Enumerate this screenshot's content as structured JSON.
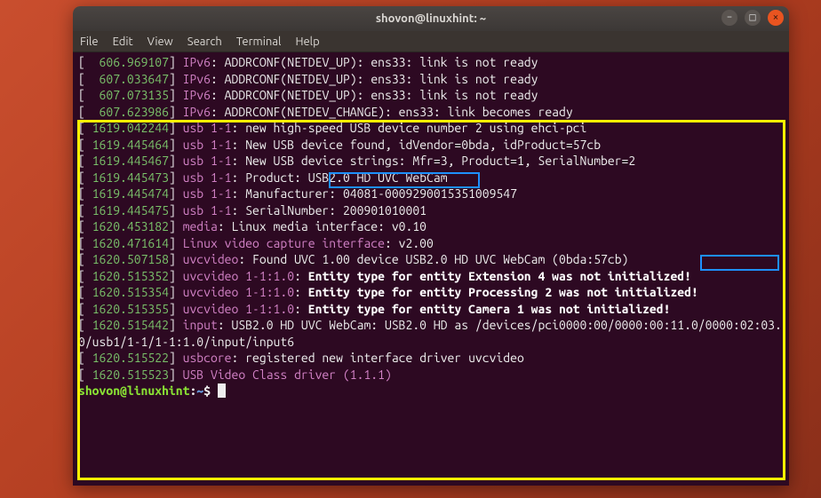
{
  "window": {
    "title": "shovon@linuxhint: ~",
    "controls": {
      "minimize": "–",
      "maximize": "□",
      "close": "×"
    }
  },
  "menu": {
    "items": [
      "File",
      "Edit",
      "View",
      "Search",
      "Terminal",
      "Help"
    ]
  },
  "terminal": {
    "lines": [
      {
        "ts": "606.969107",
        "label": "IPv6",
        "msg": ": ADDRCONF(NETDEV_UP): ens33: link is not ready"
      },
      {
        "ts": "607.033647",
        "label": "IPv6",
        "msg": ": ADDRCONF(NETDEV_UP): ens33: link is not ready"
      },
      {
        "ts": "607.073135",
        "label": "IPv6",
        "msg": ": ADDRCONF(NETDEV_UP): ens33: link is not ready"
      },
      {
        "ts": "607.623986",
        "label": "IPv6",
        "msg": ": ADDRCONF(NETDEV_CHANGE): ens33: link becomes ready"
      },
      {
        "ts": "1619.042244",
        "label": "usb 1-1",
        "msg": ": new high-speed USB device number 2 using ehci-pci"
      },
      {
        "ts": "1619.445464",
        "label": "usb 1-1",
        "msg": ": New USB device found, idVendor=0bda, idProduct=57cb"
      },
      {
        "ts": "1619.445467",
        "label": "usb 1-1",
        "msg": ": New USB device strings: Mfr=3, Product=1, SerialNumber=2"
      },
      {
        "ts": "1619.445473",
        "label": "usb 1-1",
        "msg": ": Product: USB2.0 HD UVC WebCam"
      },
      {
        "ts": "1619.445474",
        "label": "usb 1-1",
        "msg": ": Manufacturer: 04081-0009290015351009547"
      },
      {
        "ts": "1619.445475",
        "label": "usb 1-1",
        "msg": ": SerialNumber: 200901010001"
      },
      {
        "ts": "1620.453182",
        "label": "media",
        "msg": ": Linux media interface: v0.10"
      },
      {
        "ts": "1620.471614",
        "label": "Linux video capture interface",
        "msg": ": v2.00"
      },
      {
        "ts": "1620.507158",
        "label": "uvcvideo",
        "msg": ": Found UVC 1.00 device USB2.0 HD UVC WebCam (0bda:57cb)"
      },
      {
        "ts": "1620.515352",
        "label": "uvcvideo 1-1:1.0",
        "boldmsg": "Entity type for entity Extension 4 was not initialized!"
      },
      {
        "ts": "1620.515354",
        "label": "uvcvideo 1-1:1.0",
        "boldmsg": "Entity type for entity Processing 2 was not initialized!"
      },
      {
        "ts": "1620.515355",
        "label": "uvcvideo 1-1:1.0",
        "boldmsg": "Entity type for entity Camera 1 was not initialized!"
      },
      {
        "ts": "1620.515442",
        "label": "input",
        "msg": ": USB2.0 HD UVC WebCam: USB2.0 HD as /devices/pci0000:00/0000:00:11.0/0000:02:03.0/usb1/1-1/1-1:1.0/input/input6"
      },
      {
        "ts": "1620.515522",
        "label": "usbcore",
        "msg": ": registered new interface driver uvcvideo"
      },
      {
        "ts": "1620.515523",
        "label": "USB Video Class driver (1.1.1)",
        "msg": ""
      }
    ],
    "prompt": {
      "user": "shovon@linuxhint",
      "path": "~",
      "symbol": "$"
    }
  },
  "highlights": {
    "yellow_box": "dmesg-usb-section",
    "blue_box_1_text": "USB2.0 HD UVC WebCam",
    "blue_box_2_text": "(0bda:57cb)"
  }
}
